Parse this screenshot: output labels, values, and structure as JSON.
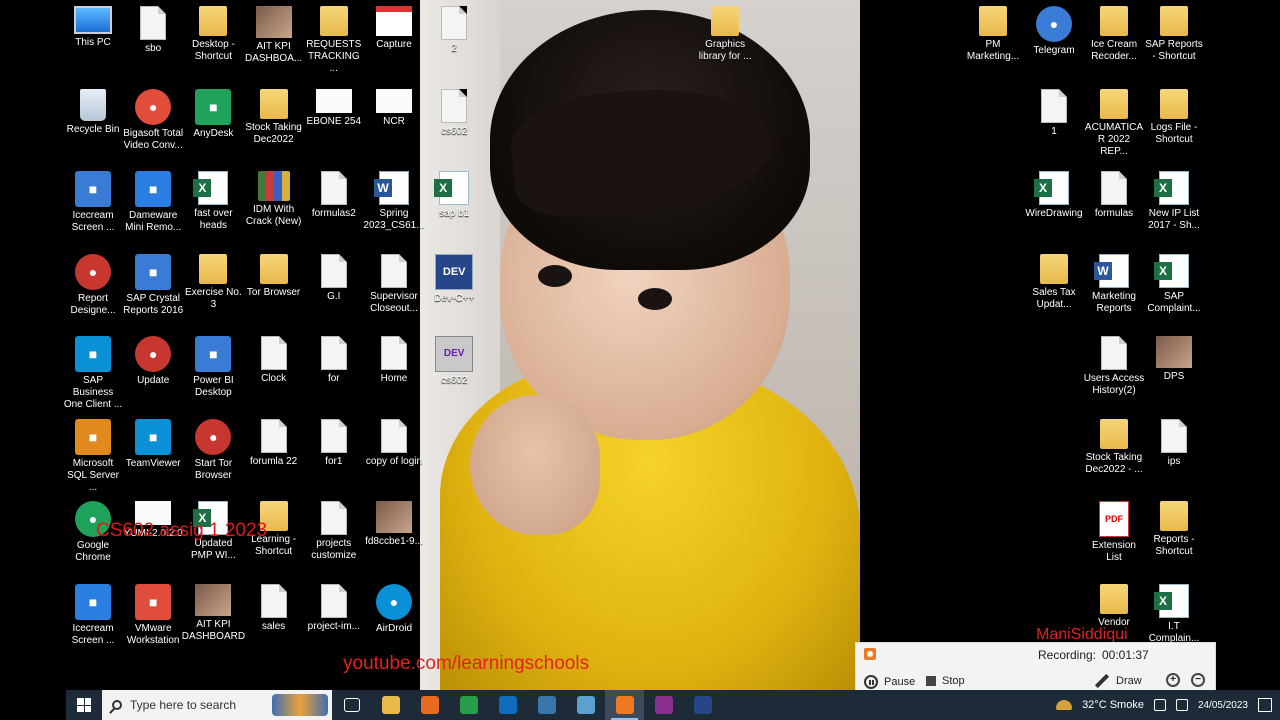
{
  "desktop": {
    "icons": [
      {
        "label": "This PC",
        "kind": "monitor"
      },
      {
        "label": "sbo",
        "kind": "doc"
      },
      {
        "label": "Desktop - Shortcut",
        "kind": "folder"
      },
      {
        "label": "AIT KPI DASHBOA...",
        "kind": "photo"
      },
      {
        "label": "REQUESTS TRACKING ...",
        "kind": "folder"
      },
      {
        "label": "Capture",
        "kind": "banner"
      },
      {
        "label": "2",
        "kind": "doc"
      },
      {
        "label": "Graphics library for ...",
        "kind": "folder"
      },
      {
        "label": "Recycle Bin",
        "kind": "bin"
      },
      {
        "label": "Bigasoft Total Video Conv...",
        "kind": "round"
      },
      {
        "label": "AnyDesk",
        "kind": "square"
      },
      {
        "label": "Stock Taking Dec2022",
        "kind": "folder"
      },
      {
        "label": "EBONE 254",
        "kind": "white"
      },
      {
        "label": "NCR",
        "kind": "white"
      },
      {
        "label": "cs602",
        "kind": "doc"
      },
      {
        "label": "Icecream Screen ...",
        "kind": "square"
      },
      {
        "label": "Dameware Mini Remo...",
        "kind": "square"
      },
      {
        "label": "fast over heads",
        "kind": "excel"
      },
      {
        "label": "IDM With Crack (New)",
        "kind": "zip"
      },
      {
        "label": "formulas2",
        "kind": "doc"
      },
      {
        "label": "Spring 2023_CS61...",
        "kind": "word"
      },
      {
        "label": "sap b1",
        "kind": "excel"
      },
      {
        "label": "Report Designe...",
        "kind": "round"
      },
      {
        "label": "SAP Crystal Reports 2016",
        "kind": "square"
      },
      {
        "label": "Exercise No. 3",
        "kind": "folder"
      },
      {
        "label": "Tor Browser",
        "kind": "folder"
      },
      {
        "label": "G.I",
        "kind": "doc"
      },
      {
        "label": "Supervisor Closeout...",
        "kind": "doc"
      },
      {
        "label": "Dev-C++",
        "kind": "dev"
      },
      {
        "label": "SAP Business One Client ...",
        "kind": "square"
      },
      {
        "label": "Update",
        "kind": "round"
      },
      {
        "label": "Power BI Desktop",
        "kind": "square"
      },
      {
        "label": "Clock",
        "kind": "doc"
      },
      {
        "label": "for",
        "kind": "doc"
      },
      {
        "label": "Home",
        "kind": "doc"
      },
      {
        "label": "cs602",
        "kind": "dev2"
      },
      {
        "label": "Microsoft SQL Server ...",
        "kind": "square"
      },
      {
        "label": "TeamViewer",
        "kind": "square"
      },
      {
        "label": "Start Tor Browser",
        "kind": "round"
      },
      {
        "label": "forumla 22",
        "kind": "doc"
      },
      {
        "label": "for1",
        "kind": "doc"
      },
      {
        "label": "copy of login",
        "kind": "doc"
      },
      {
        "label": "Google Chrome",
        "kind": "round"
      },
      {
        "label": "YUMI-2.0.2.0",
        "kind": "white"
      },
      {
        "label": "Updated PMP WI...",
        "kind": "excel"
      },
      {
        "label": "Learning - Shortcut",
        "kind": "folder"
      },
      {
        "label": "projects customize",
        "kind": "doc"
      },
      {
        "label": "fd8ccbe1-9...",
        "kind": "photo"
      },
      {
        "label": "Icecream Screen ...",
        "kind": "square"
      },
      {
        "label": "VMware Workstation",
        "kind": "square"
      },
      {
        "label": "AIT KPI DASHBOARD",
        "kind": "photo"
      },
      {
        "label": "sales",
        "kind": "doc"
      },
      {
        "label": "project-im...",
        "kind": "doc"
      },
      {
        "label": "AirDroid",
        "kind": "round"
      },
      {
        "label": "PM Marketing...",
        "kind": "folder"
      },
      {
        "label": "Telegram",
        "kind": "round"
      },
      {
        "label": "Ice Cream Recoder...",
        "kind": "folder"
      },
      {
        "label": "SAP Reports - Shortcut",
        "kind": "folder"
      },
      {
        "label": "1",
        "kind": "doc"
      },
      {
        "label": "ACUMATICA R 2022 REP...",
        "kind": "folder"
      },
      {
        "label": "Logs File - Shortcut",
        "kind": "folder"
      },
      {
        "label": "WireDrawing",
        "kind": "excel"
      },
      {
        "label": "formulas",
        "kind": "doc"
      },
      {
        "label": "New IP List 2017 - Sh...",
        "kind": "excel"
      },
      {
        "label": "Sales Tax Updat...",
        "kind": "folder"
      },
      {
        "label": "Marketing Reports",
        "kind": "word"
      },
      {
        "label": "SAP Complaint...",
        "kind": "excel"
      },
      {
        "label": "Users Access History(2)",
        "kind": "doc"
      },
      {
        "label": "DPS",
        "kind": "photo"
      },
      {
        "label": "Stock Taking Dec2022 - ...",
        "kind": "folder"
      },
      {
        "label": "ips",
        "kind": "doc"
      },
      {
        "label": "Extension List",
        "kind": "pdf"
      },
      {
        "label": "Reports - Shortcut",
        "kind": "folder"
      },
      {
        "label": "Vendor",
        "kind": "folder"
      },
      {
        "label": "I.T Complain...",
        "kind": "excel"
      }
    ]
  },
  "overlays": {
    "cs_text": "CS602 assig 1 2023",
    "youtube": "youtube.com/learningschools",
    "mani": "ManiSiddiqui"
  },
  "recorder": {
    "status_label": "Recording:",
    "time": "00:01:37",
    "pause_label": "Pause",
    "stop_label": "Stop",
    "draw_label": "Draw"
  },
  "taskbar": {
    "search_placeholder": "Type here to search",
    "apps": [
      "task-view",
      "file-explorer",
      "firefox",
      "chrome",
      "outlook",
      "python",
      "notepad",
      "icecream",
      "winrar",
      "dev-cpp"
    ],
    "weather": "32°C Smoke",
    "date": "24/05/2023"
  }
}
